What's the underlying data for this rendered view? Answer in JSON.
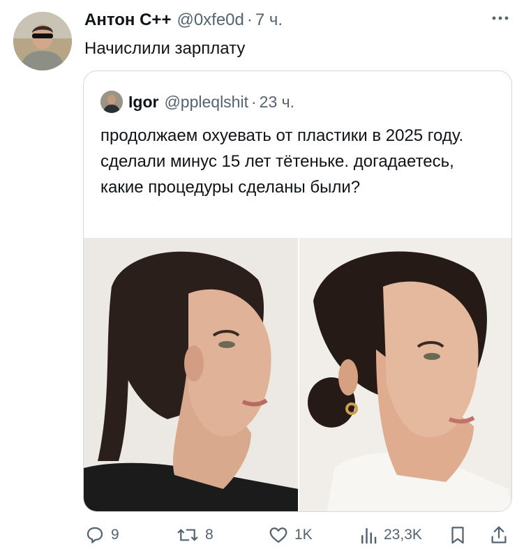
{
  "tweet": {
    "author_name": "Антон С++",
    "handle": "@0xfe0d",
    "time": "7 ч.",
    "text": "Начислили зарплату"
  },
  "quote": {
    "author_name": "Igor",
    "handle": "@ppleqlshit",
    "time": "23 ч.",
    "text": "продолжаем охуевать от пластики в 2025 году. сделали минус 15 лет тётеньке. догадаетесь, какие процедуры сделаны были?"
  },
  "actions": {
    "replies": "9",
    "retweets": "8",
    "likes": "1K",
    "views": "23,3K"
  },
  "icons": [
    "more-icon",
    "reply-icon",
    "retweet-icon",
    "like-icon",
    "views-icon",
    "bookmark-icon",
    "share-icon"
  ],
  "colors": {
    "text": "#0f1419",
    "secondary": "#536471",
    "border": "#cfd9de"
  }
}
